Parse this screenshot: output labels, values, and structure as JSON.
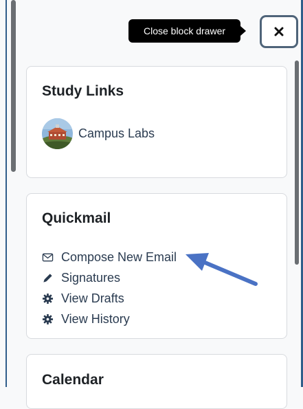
{
  "tooltip": {
    "text": "Close block drawer"
  },
  "close_button": {
    "icon": "close-icon"
  },
  "blocks": {
    "study_links": {
      "title": "Study Links",
      "items": [
        {
          "label": "Campus Labs",
          "icon": "campus-building-avatar"
        }
      ]
    },
    "quickmail": {
      "title": "Quickmail",
      "items": [
        {
          "label": "Compose New Email",
          "icon": "envelope-icon"
        },
        {
          "label": "Signatures",
          "icon": "pencil-icon"
        },
        {
          "label": "View Drafts",
          "icon": "gear-icon"
        },
        {
          "label": "View History",
          "icon": "gear-icon"
        }
      ]
    },
    "calendar": {
      "title": "Calendar"
    }
  },
  "colors": {
    "link": "#2a3b50",
    "annotation_arrow": "#4a72c4",
    "frame": "#2f5d8a"
  }
}
